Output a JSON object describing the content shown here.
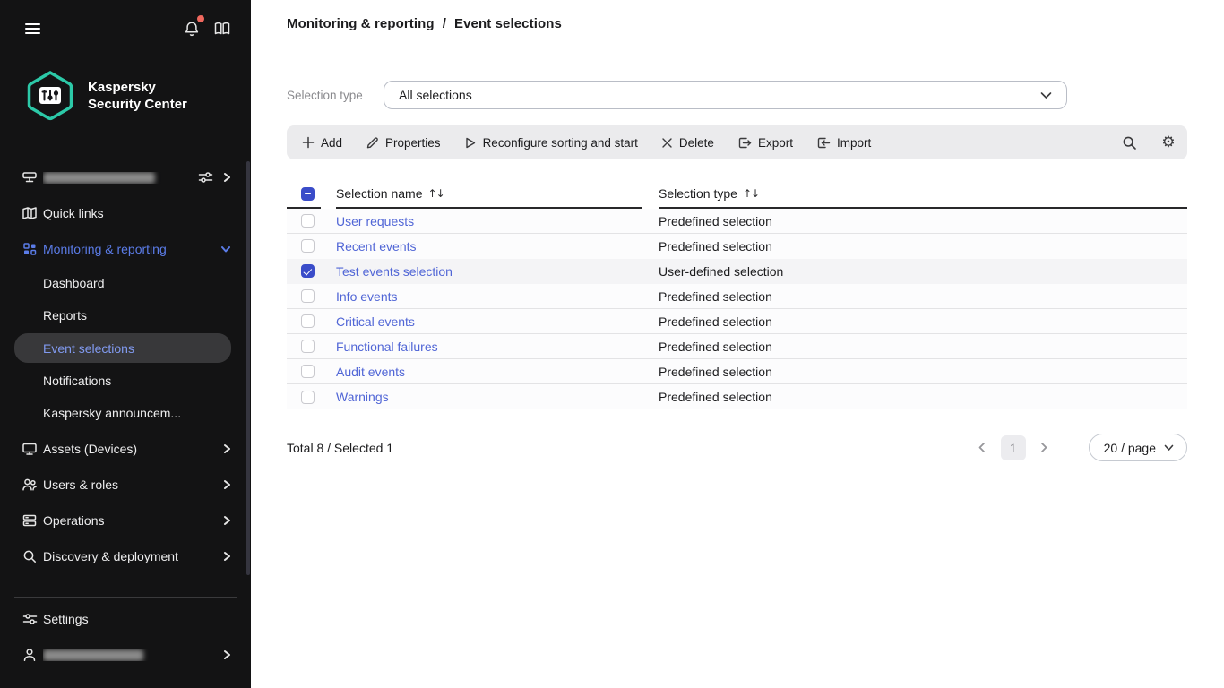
{
  "brand": {
    "line1": "Kaspersky",
    "line2": "Security Center"
  },
  "sidebar": {
    "quick_links": "Quick links",
    "monitoring": "Monitoring & reporting",
    "dashboard": "Dashboard",
    "reports": "Reports",
    "event_selections": "Event selections",
    "notifications": "Notifications",
    "announcements": "Kaspersky announcem...",
    "assets": "Assets (Devices)",
    "users_roles": "Users & roles",
    "operations": "Operations",
    "discovery": "Discovery & deployment",
    "settings": "Settings"
  },
  "header": {
    "breadcrumb_parent": "Monitoring & reporting",
    "breadcrumb_separator": "/",
    "breadcrumb_current": "Event selections"
  },
  "filter": {
    "label": "Selection type",
    "value": "All selections"
  },
  "toolbar": {
    "add": "Add",
    "properties": "Properties",
    "reconfigure": "Reconfigure sorting and start",
    "delete": "Delete",
    "export": "Export",
    "import": "Import"
  },
  "table": {
    "header_indeterminate": true,
    "columns": {
      "name": "Selection name",
      "type": "Selection type"
    },
    "rows": [
      {
        "name": "User requests",
        "type": "Predefined selection",
        "checked": false
      },
      {
        "name": "Recent events",
        "type": "Predefined selection",
        "checked": false
      },
      {
        "name": "Test events selection",
        "type": "User-defined selection",
        "checked": true
      },
      {
        "name": "Info events",
        "type": "Predefined selection",
        "checked": false
      },
      {
        "name": "Critical events",
        "type": "Predefined selection",
        "checked": false
      },
      {
        "name": "Functional failures",
        "type": "Predefined selection",
        "checked": false
      },
      {
        "name": "Audit events",
        "type": "Predefined selection",
        "checked": false
      },
      {
        "name": "Warnings",
        "type": "Predefined selection",
        "checked": false
      }
    ]
  },
  "footer": {
    "total": "Total 8 / Selected 1",
    "page": "1",
    "page_size": "20 / page"
  },
  "colors": {
    "accent_link": "#5166d6",
    "sidebar_active_blue": "#5b7ce8",
    "checkbox_blue": "#3a4cc9",
    "brand_teal": "#2cc9a8",
    "notification_red": "#f0685e"
  }
}
